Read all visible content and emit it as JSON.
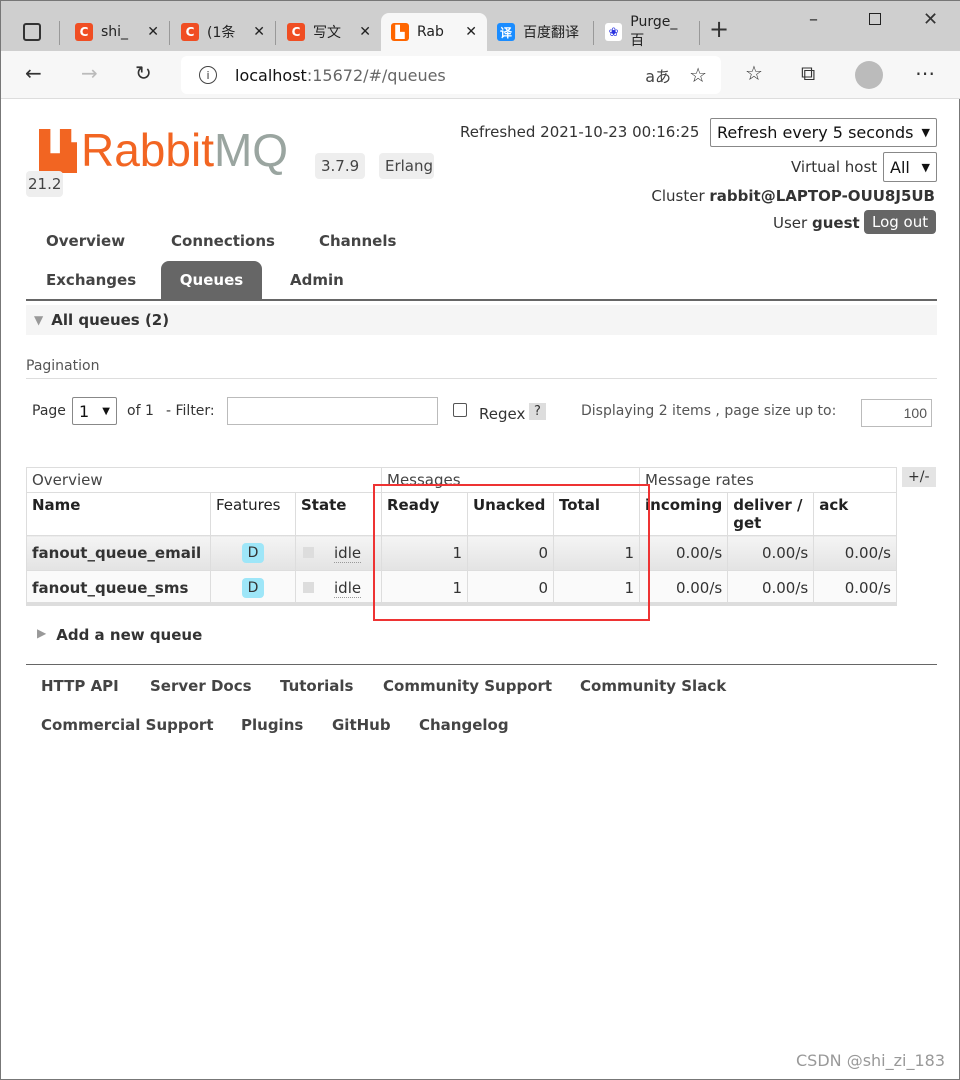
{
  "browser": {
    "tabs": [
      {
        "label": "shi_",
        "icon": "csdn-icon"
      },
      {
        "label": "(1条",
        "icon": "csdn-icon"
      },
      {
        "label": "写文",
        "icon": "csdn-icon"
      },
      {
        "label": "Rab",
        "icon": "rabbitmq-icon"
      },
      {
        "label": "百度翻译",
        "icon": "translate-icon"
      },
      {
        "label": "Purge_百",
        "icon": "baidu-icon"
      }
    ],
    "url_host": "localhost",
    "url_rest": ":15672/#/queues",
    "translate_label": "aあ"
  },
  "header": {
    "logo": "RabbitMQ",
    "version": "3.7.9",
    "erlang": "Erlang 21.2",
    "refreshed": "Refreshed 2021-10-23 00:16:25",
    "refresh_select": "Refresh every 5 seconds",
    "vhost_label": "Virtual host",
    "vhost_value": "All",
    "cluster_label": "Cluster",
    "cluster_value": "rabbit@LAPTOP-OUU8J5UB",
    "user_label": "User",
    "user_value": "guest",
    "logout": "Log out"
  },
  "nav": [
    "Overview",
    "Connections",
    "Channels",
    "Exchanges",
    "Queues",
    "Admin"
  ],
  "section": {
    "title": "All queues (2)",
    "pagination": "Pagination",
    "page_label": "Page",
    "page_value": "1",
    "of": "of 1",
    "filter_label": "- Filter:",
    "filter_value": "",
    "regex": "Regex",
    "help": "?",
    "displaying": "Displaying 2 items , page size up to:",
    "page_size": "100"
  },
  "table": {
    "groups": [
      "Overview",
      "Messages",
      "Message rates"
    ],
    "toggle": "+/-",
    "headers": [
      "Name",
      "Features",
      "State",
      "Ready",
      "Unacked",
      "Total",
      "incoming",
      "deliver / get",
      "ack"
    ],
    "rows": [
      {
        "name": "fanout_queue_email",
        "feature": "D",
        "state": "idle",
        "ready": "1",
        "unacked": "0",
        "total": "1",
        "incoming": "0.00/s",
        "deliver": "0.00/s",
        "ack": "0.00/s"
      },
      {
        "name": "fanout_queue_sms",
        "feature": "D",
        "state": "idle",
        "ready": "1",
        "unacked": "0",
        "total": "1",
        "incoming": "0.00/s",
        "deliver": "0.00/s",
        "ack": "0.00/s"
      }
    ]
  },
  "add_queue": "Add a new queue",
  "footer": [
    "HTTP API",
    "Server Docs",
    "Tutorials",
    "Community Support",
    "Community Slack",
    "Commercial Support",
    "Plugins",
    "GitHub",
    "Changelog"
  ],
  "watermark": "CSDN @shi_zi_183",
  "colors": {
    "brand": "#f26522",
    "highlight_box": "#e33"
  }
}
